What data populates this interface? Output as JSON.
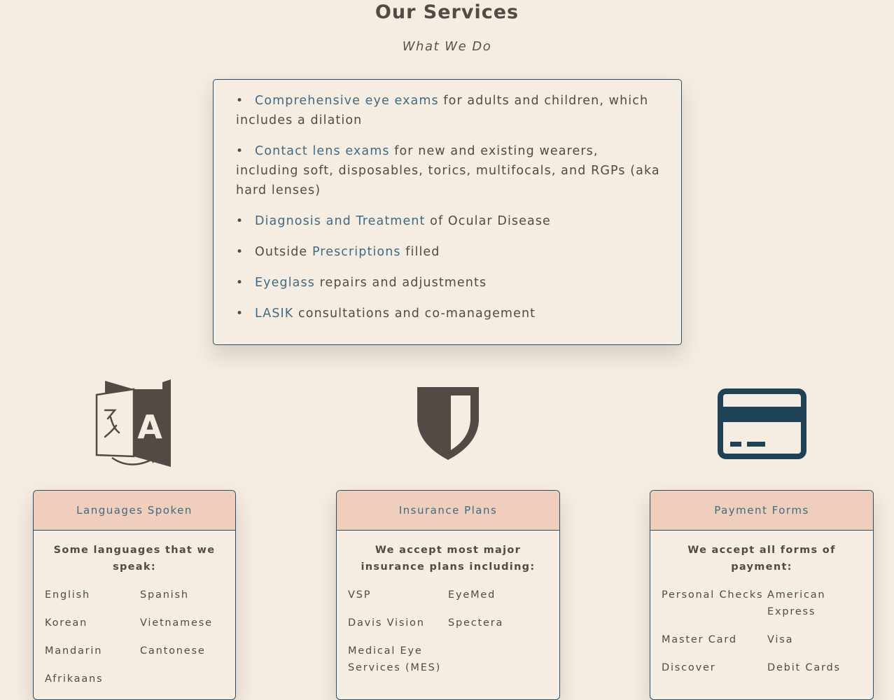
{
  "header": {
    "title": "Our Services",
    "subtitle": "What We Do"
  },
  "services": [
    {
      "link": "Comprehensive eye exams",
      "prefix": "",
      "text": " for adults and children, which includes a dilation"
    },
    {
      "link": "Contact lens exams",
      "prefix": "",
      "text": " for new and existing wearers, including soft, disposables, torics, multifocals, and RGPs (aka hard lenses)"
    },
    {
      "link": "Diagnosis and Treatment",
      "prefix": "",
      "text": " of Ocular Disease"
    },
    {
      "link": "Prescriptions",
      "prefix": "Outside ",
      "text": " filled"
    },
    {
      "link": "Eyeglass",
      "prefix": "",
      "text": " repairs and adjustments"
    },
    {
      "link": "LASIK",
      "prefix": "",
      "text": " consultations and co-management"
    }
  ],
  "languages": {
    "icon": "translate-icon",
    "header": "Languages Spoken",
    "intro": "Some languages that we speak:",
    "items": [
      "English",
      "Spanish",
      "Korean",
      "Vietnamese",
      "Mandarin",
      "Cantonese",
      "Afrikaans"
    ]
  },
  "insurance": {
    "icon": "shield-icon",
    "header": "Insurance Plans",
    "intro": "We accept most major insurance plans including:",
    "items": [
      "VSP",
      "EyeMed",
      "Davis Vision",
      "Spectera",
      "Medical Eye Services (MES)"
    ]
  },
  "payment": {
    "icon": "credit-card-icon",
    "header": "Payment Forms",
    "intro": "We accept all forms of payment:",
    "items": [
      "Personal Checks",
      "American Express",
      "Master Card",
      "Visa",
      "Discover",
      "Debit Cards"
    ]
  },
  "colors": {
    "background": "#f5ece2",
    "text": "#524b45",
    "link": "#3f6b84",
    "border": "#2e4f63",
    "card_header": "#efcfbc",
    "card_icon": "#1f4257"
  }
}
